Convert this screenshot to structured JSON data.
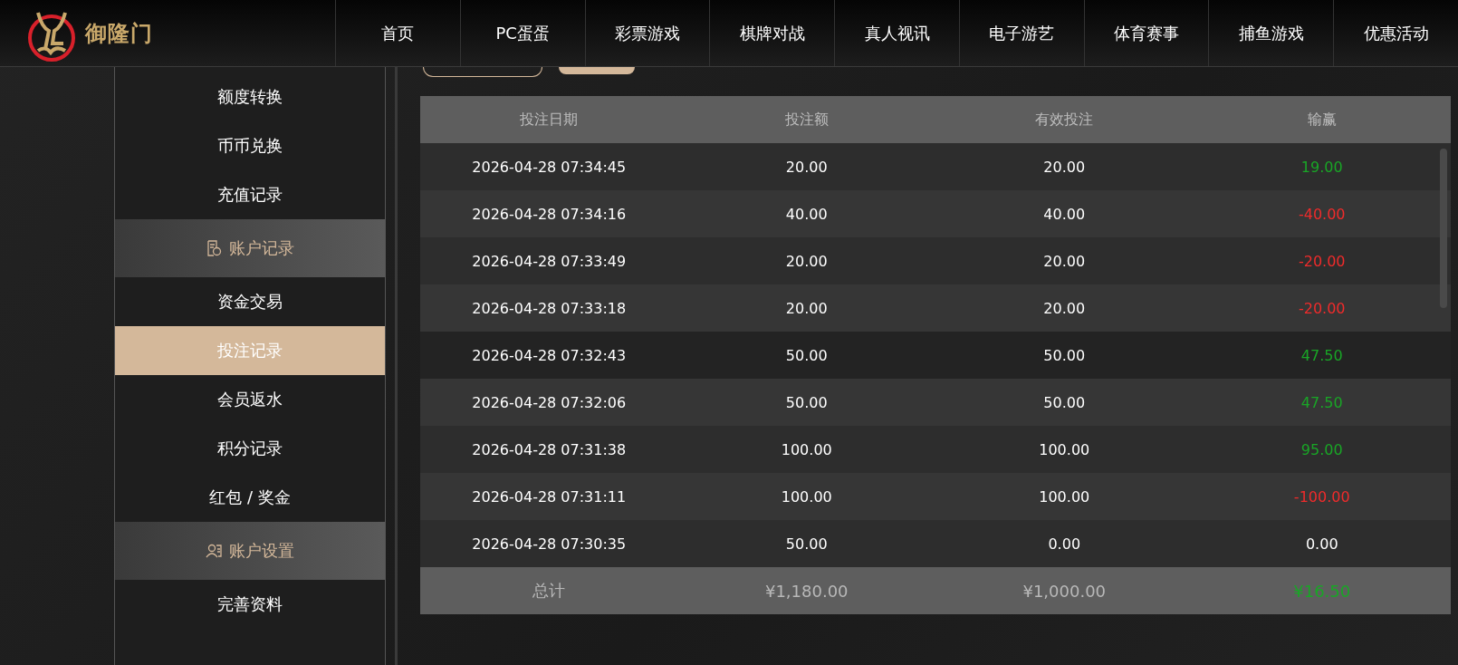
{
  "header": {
    "logo_text": "御隆门",
    "nav": [
      {
        "label": "首页",
        "selected": false
      },
      {
        "label": "PC蛋蛋",
        "selected": false
      },
      {
        "label": "彩票游戏",
        "selected": false
      },
      {
        "label": "棋牌对战",
        "selected": false
      },
      {
        "label": "真人视讯",
        "selected": false
      },
      {
        "label": "电子游艺",
        "selected": false
      },
      {
        "label": "体育赛事",
        "selected": false
      },
      {
        "label": "捕鱼游戏",
        "selected": false
      },
      {
        "label": "优惠活动",
        "selected": false
      }
    ]
  },
  "sidebar": {
    "items": [
      {
        "kind": "item",
        "label": "额度转换",
        "selected": false
      },
      {
        "kind": "item",
        "label": "币币兑换",
        "selected": false
      },
      {
        "kind": "item",
        "label": "充值记录",
        "selected": false
      },
      {
        "kind": "group",
        "label": "账户记录"
      },
      {
        "kind": "item",
        "label": "资金交易",
        "selected": false
      },
      {
        "kind": "item",
        "label": "投注记录",
        "selected": true
      },
      {
        "kind": "item",
        "label": "会员返水",
        "selected": false
      },
      {
        "kind": "item",
        "label": "积分记录",
        "selected": false
      },
      {
        "kind": "item",
        "label": "红包 / 奖金",
        "selected": false
      },
      {
        "kind": "group",
        "label": "账户设置"
      },
      {
        "kind": "item",
        "label": "完善资料",
        "selected": false
      }
    ]
  },
  "table": {
    "columns": [
      "投注日期",
      "投注额",
      "有效投注",
      "输赢"
    ],
    "rows": [
      {
        "date": "2026-04-28 07:34:45",
        "amount": "20.00",
        "valid": "20.00",
        "result": "19.00",
        "color": "#19a626"
      },
      {
        "date": "2026-04-28 07:34:16",
        "amount": "40.00",
        "valid": "40.00",
        "result": "-40.00",
        "color": "#f02b2b"
      },
      {
        "date": "2026-04-28 07:33:49",
        "amount": "20.00",
        "valid": "20.00",
        "result": "-20.00",
        "color": "#f02b2b"
      },
      {
        "date": "2026-04-28 07:33:18",
        "amount": "20.00",
        "valid": "20.00",
        "result": "-20.00",
        "color": "#f02b2b"
      },
      {
        "date": "2026-04-28 07:32:43",
        "amount": "50.00",
        "valid": "50.00",
        "result": "47.50",
        "color": "#19a626"
      },
      {
        "date": "2026-04-28 07:32:06",
        "amount": "50.00",
        "valid": "50.00",
        "result": "47.50",
        "color": "#19a626"
      },
      {
        "date": "2026-04-28 07:31:38",
        "amount": "100.00",
        "valid": "100.00",
        "result": "95.00",
        "color": "#19a626"
      },
      {
        "date": "2026-04-28 07:31:11",
        "amount": "100.00",
        "valid": "100.00",
        "result": "-100.00",
        "color": "#f02b2b"
      },
      {
        "date": "2026-04-28 07:30:35",
        "amount": "50.00",
        "valid": "0.00",
        "result": "0.00",
        "color": "#ffffff"
      }
    ],
    "total": {
      "label": "总计",
      "amount": "¥1,180.00",
      "valid": "¥1,000.00",
      "result": "¥16.50",
      "color": "#19a626"
    }
  }
}
